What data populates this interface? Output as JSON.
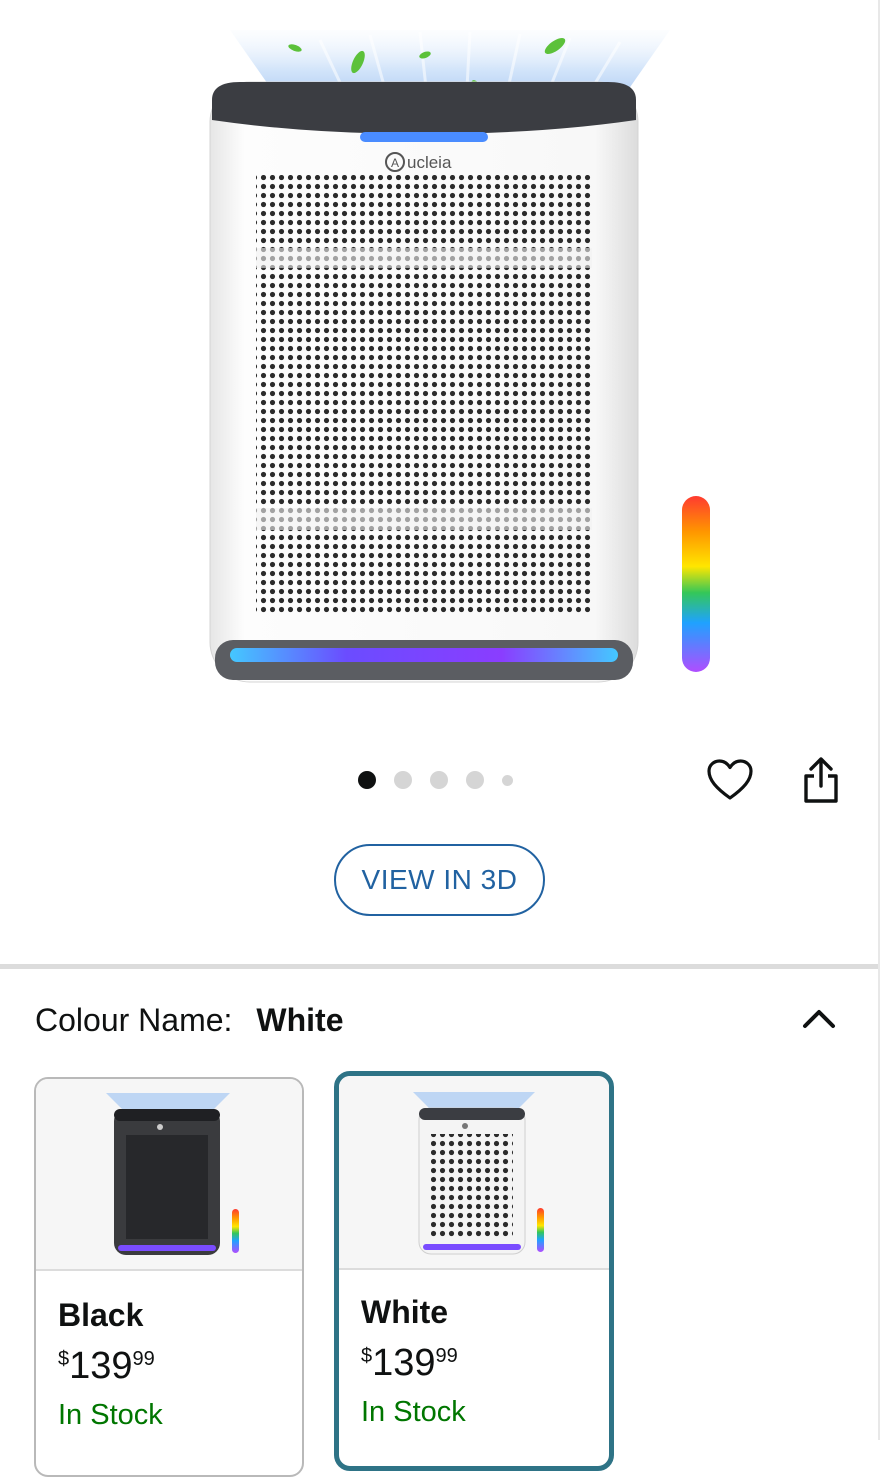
{
  "product": {
    "brand_logo": "Aucleia",
    "gallery": {
      "slide_count": 5,
      "active_slide": 1
    },
    "view_3d_label": "VIEW IN 3D"
  },
  "icons": {
    "wishlist": "heart-icon",
    "share": "share-icon",
    "collapse": "chevron-up-icon"
  },
  "variant": {
    "label": "Colour Name:",
    "selected": "White",
    "options": [
      {
        "name": "Black",
        "currency": "$",
        "price_whole": "139",
        "price_fraction": "99",
        "availability": "In Stock"
      },
      {
        "name": "White",
        "currency": "$",
        "price_whole": "139",
        "price_fraction": "99",
        "availability": "In Stock"
      }
    ]
  },
  "colors": {
    "link_blue": "#2162a1",
    "selected_border": "#2e7386",
    "in_stock_green": "#007600"
  }
}
